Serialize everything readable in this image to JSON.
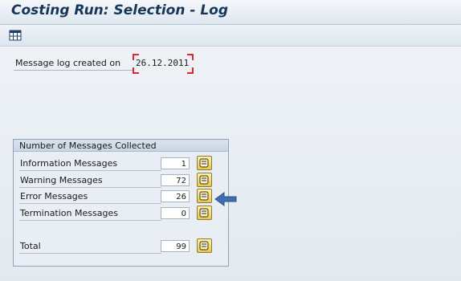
{
  "window": {
    "title": "Costing Run: Selection - Log"
  },
  "toolbar": {
    "layout_button_icon": "grid-layout-icon"
  },
  "header_fields": {
    "created_label": "Message log created on",
    "created_date": "26.12.2011"
  },
  "messages_group": {
    "title": "Number of Messages Collected",
    "rows": [
      {
        "label": "Information Messages",
        "count": "1"
      },
      {
        "label": "Warning Messages",
        "count": "72"
      },
      {
        "label": "Error Messages",
        "count": "26"
      },
      {
        "label": "Termination Messages",
        "count": "0"
      }
    ],
    "total_label": "Total",
    "total_count": "99",
    "detail_icon": "scroll-log-icon"
  },
  "annotation": {
    "arrow_icon": "left-arrow-icon",
    "arrow_color": "#3f6fb0"
  },
  "colors": {
    "title_text": "#16365a",
    "required_marker": "#e0262b"
  }
}
